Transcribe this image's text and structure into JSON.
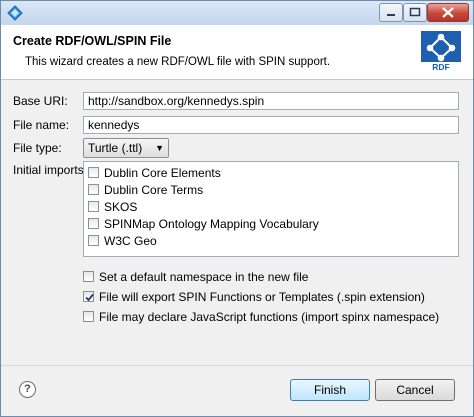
{
  "header": {
    "title": "Create RDF/OWL/SPIN File",
    "description": "This wizard creates a new RDF/OWL file with SPIN support.",
    "logo_text": "RDF"
  },
  "form": {
    "base_uri_label": "Base URI:",
    "base_uri_value": "http://sandbox.org/kennedys.spin",
    "file_name_label": "File name:",
    "file_name_value": "kennedys",
    "file_type_label": "File type:",
    "file_type_value": "Turtle (.ttl)",
    "initial_imports_label": "Initial imports:",
    "imports": [
      {
        "label": "Dublin Core Elements",
        "checked": false
      },
      {
        "label": "Dublin Core Terms",
        "checked": false
      },
      {
        "label": "SKOS",
        "checked": false
      },
      {
        "label": "SPINMap Ontology Mapping Vocabulary",
        "checked": false
      },
      {
        "label": "W3C Geo",
        "checked": false
      }
    ],
    "options": [
      {
        "label": "Set a default namespace in the new file",
        "checked": false
      },
      {
        "label": "File will export SPIN Functions or Templates (.spin extension)",
        "checked": true
      },
      {
        "label": "File may declare JavaScript functions (import spinx namespace)",
        "checked": false
      }
    ]
  },
  "footer": {
    "help_glyph": "?",
    "finish_label": "Finish",
    "cancel_label": "Cancel"
  },
  "colors": {
    "titlebar": "#c3d6ee",
    "close_button": "#c8463a",
    "logo_blue": "#1f5fb0"
  }
}
